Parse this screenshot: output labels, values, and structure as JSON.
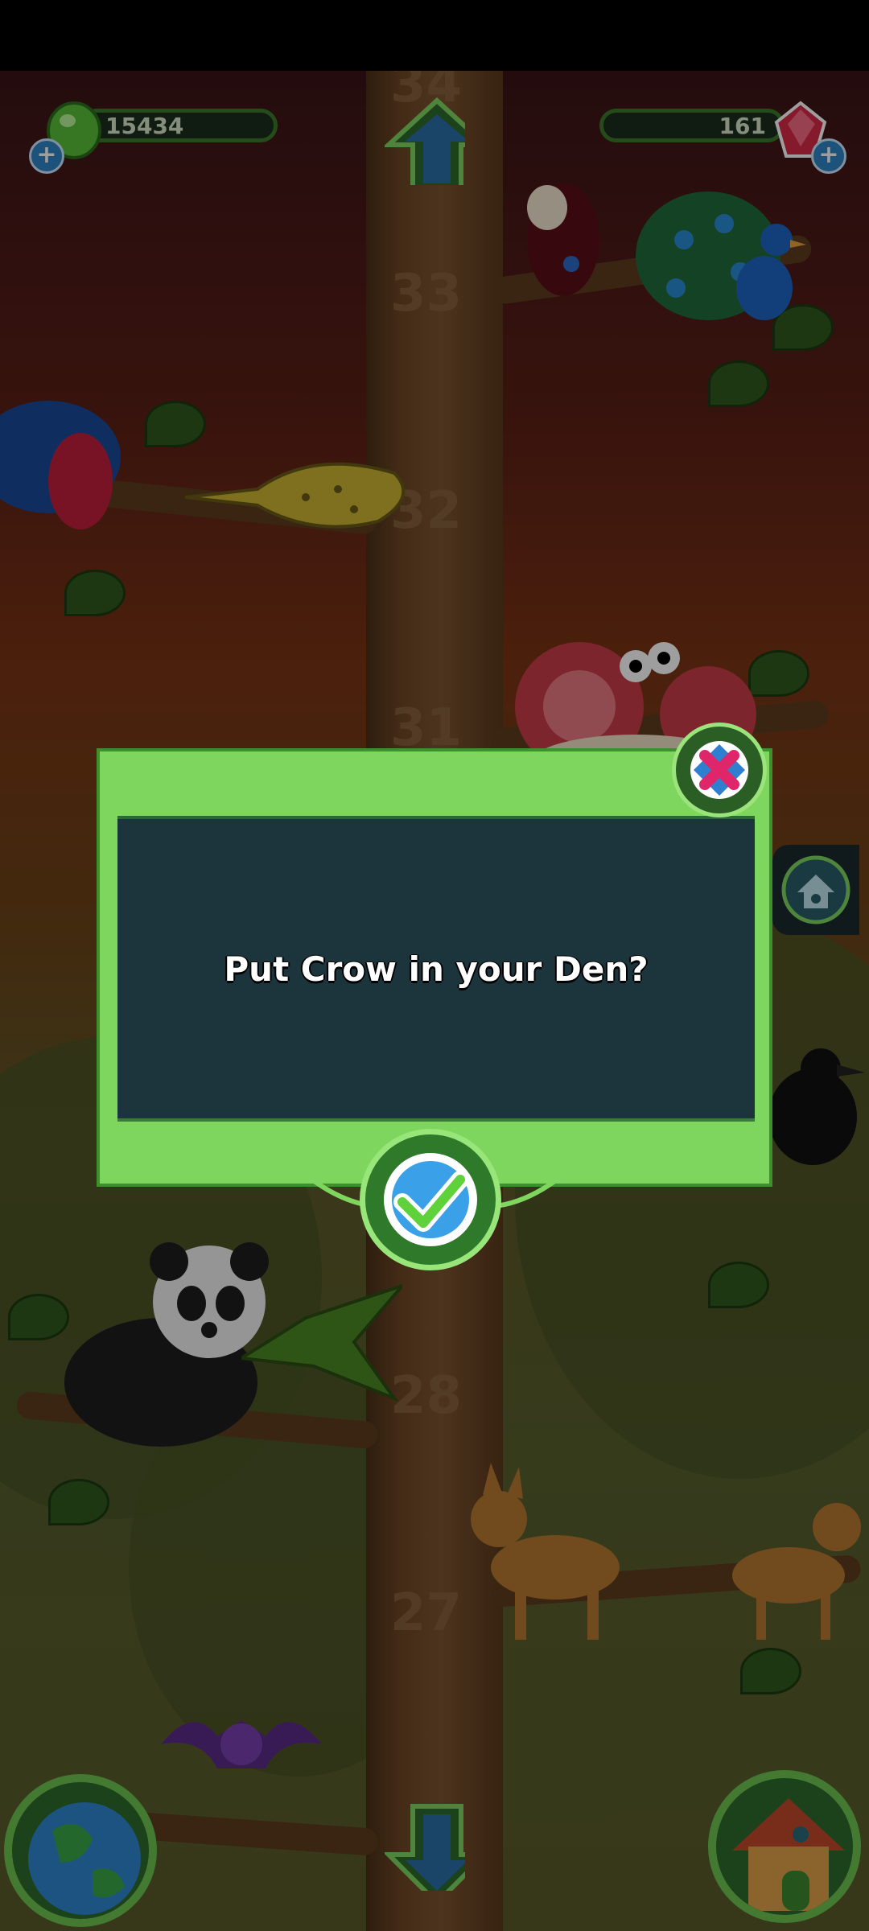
{
  "hud": {
    "green_currency": "15434",
    "red_currency": "161"
  },
  "tree_levels": [
    "34",
    "33",
    "32",
    "31",
    "28",
    "27"
  ],
  "dialog": {
    "message": "Put Crow in your Den?"
  },
  "icons": {
    "green_gem": "green-gem-icon",
    "red_gem": "red-gem-icon",
    "close": "close-icon",
    "confirm": "check-icon",
    "up": "arrow-up-icon",
    "down": "arrow-down-icon",
    "globe": "globe-icon",
    "den": "den-house-icon"
  },
  "colors": {
    "dialog_green": "#7fd65f",
    "dialog_panel": "#1c353d",
    "close_accent": "#e0266a",
    "confirm_accent": "#3aa0e8"
  }
}
